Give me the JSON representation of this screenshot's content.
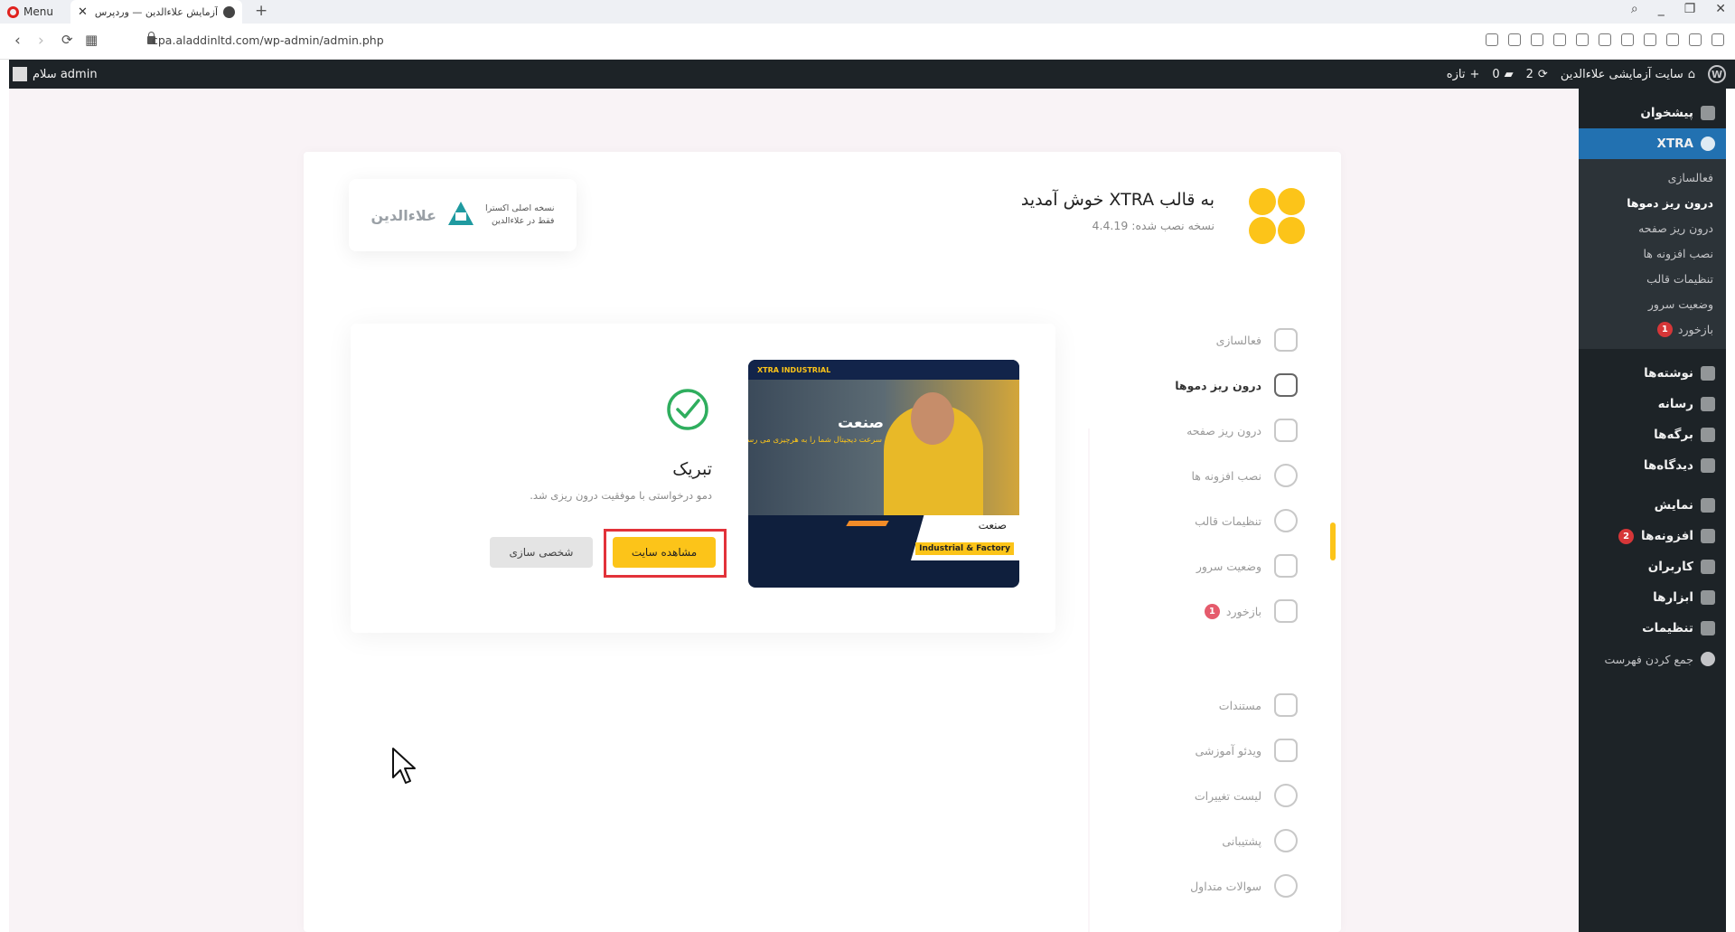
{
  "browser": {
    "menu_label": "Menu",
    "tab_title": "آزمایش علاءالدین — وردپرس",
    "tab_close": "✕",
    "new_tab": "+",
    "win_search": "⌕",
    "win_min": "_",
    "win_restore": "❐",
    "win_close": "✕",
    "back": "‹",
    "forward": "›",
    "reload": "⟳",
    "grid": "▦",
    "url": "cpa.aladdinltd.com/wp-admin/admin.php"
  },
  "admin_bar": {
    "site_name": "سایت آزمایشی علاءالدین",
    "updates_count": "2",
    "comments_count": "0",
    "new_label": "تازه",
    "greeting": "سلام admin",
    "wp_logo": "W"
  },
  "wp_menu": {
    "dashboard": "پیشخوان",
    "xtra": "XTRA",
    "xtra_sub": [
      "فعالسازی",
      "درون ریز دموها",
      "درون ریز صفحه",
      "نصب افزونه ها",
      "تنظیمات قالب",
      "وضعیت سرور",
      "بازخورد"
    ],
    "feedback_badge": "1",
    "posts": "نوشته‌ها",
    "media": "رسانه",
    "pages": "برگه‌ها",
    "comments": "دیدگاه‌ها",
    "appearance": "نمایش",
    "plugins": "افزونه‌ها",
    "plugins_badge": "2",
    "users": "کاربران",
    "tools": "ابزارها",
    "settings": "تنظیمات",
    "collapse": "جمع کردن فهرست"
  },
  "panel": {
    "welcome": "به قالب XTRA خوش آمدید",
    "version": "نسخه نصب شده: 4.4.19",
    "brand_line1": "نسخه اصلی اکسترا",
    "brand_line2": "فقط در علاءالدین",
    "brand_name": "علاءالدین"
  },
  "side_nav": {
    "activation": "فعالسازی",
    "demo_importer": "درون ریز دموها",
    "page_importer": "درون ریز صفحه",
    "plugin_install": "نصب افزونه ها",
    "theme_options": "تنظیمات قالب",
    "server_status": "وضعیت سرور",
    "feedback": "بازخورد",
    "feedback_badge": "1",
    "docs": "مستندات",
    "video": "ویدئو آموزشی",
    "changelog": "لیست تغییرات",
    "support": "پشتیبانی",
    "faq": "سوالات متداول"
  },
  "success": {
    "title": "تبریک",
    "message": "دمو درخواستی با موفقیت درون ریزی شد.",
    "view_button": "مشاهده سایت",
    "customize_button": "شخصی سازی"
  },
  "demo_preview": {
    "brand": "XTRA INDUSTRIAL",
    "hero_title": "صنعت",
    "hero_subtitle": "سرعت دیجیتال شما را به هرچیزی می رساند",
    "card_title": "صنعت",
    "card_tag": "Industrial & Factory"
  },
  "colors": {
    "accent": "#fcc419",
    "admin_dark": "#1d2327",
    "active_blue": "#2271b1",
    "highlight_red": "#e2323a",
    "success_green": "#2fae5e"
  }
}
